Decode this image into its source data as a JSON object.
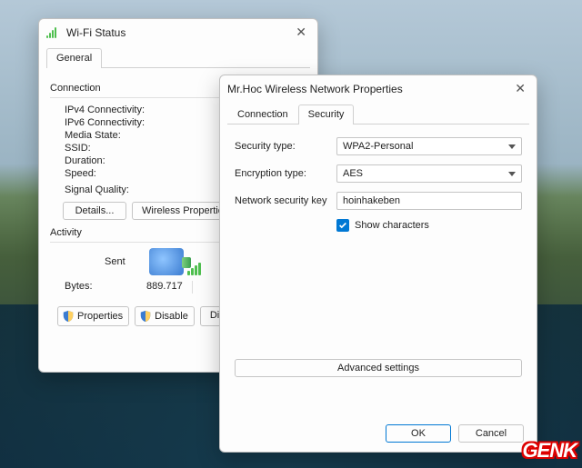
{
  "wifi_status": {
    "title": "Wi-Fi Status",
    "tab_general": "General",
    "connection_label": "Connection",
    "ipv4": "IPv4 Connectivity:",
    "ipv6": "IPv6 Connectivity:",
    "media": "Media State:",
    "ssid": "SSID:",
    "duration": "Duration:",
    "speed": "Speed:",
    "signal": "Signal Quality:",
    "btn_details": "Details...",
    "btn_wireless": "Wireless Properties",
    "activity_label": "Activity",
    "sent_label": "Sent",
    "bytes_label": "Bytes:",
    "bytes_value": "889.717",
    "btn_properties": "Properties",
    "btn_disable": "Disable",
    "btn_diagnose": "Diagn"
  },
  "properties": {
    "title": "Mr.Hoc Wireless Network Properties",
    "tab_connection": "Connection",
    "tab_security": "Security",
    "security_type_label": "Security type:",
    "security_type_value": "WPA2-Personal",
    "encryption_label": "Encryption type:",
    "encryption_value": "AES",
    "key_label": "Network security key",
    "key_value": "hoinhakeben",
    "show_chars": "Show characters",
    "advanced": "Advanced settings",
    "ok": "OK",
    "cancel": "Cancel"
  },
  "logo": "GENK"
}
